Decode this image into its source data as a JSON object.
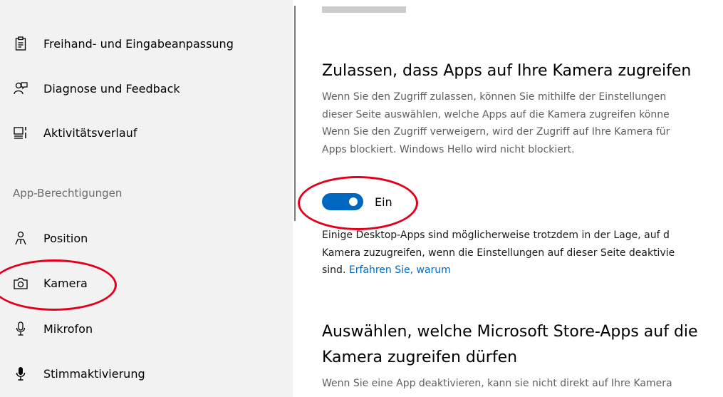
{
  "sidebar": {
    "items": [
      {
        "label": "Freihand- und Eingabeanpassung",
        "icon": "clipboard-icon"
      },
      {
        "label": "Diagnose und Feedback",
        "icon": "feedback-person-icon"
      },
      {
        "label": "Aktivitätsverlauf",
        "icon": "timeline-icon"
      }
    ],
    "section_label": "App-Berechtigungen",
    "permissions": [
      {
        "label": "Position",
        "icon": "location-person-icon"
      },
      {
        "label": "Kamera",
        "icon": "camera-icon"
      },
      {
        "label": "Mikrofon",
        "icon": "microphone-icon"
      },
      {
        "label": "Stimmaktivierung",
        "icon": "voice-activation-icon"
      }
    ]
  },
  "main": {
    "heading1": "Zulassen, dass Apps auf Ihre Kamera zugreifen",
    "desc1": [
      "Wenn Sie den Zugriff zulassen, können Sie mithilfe der Einstellungen",
      "dieser Seite auswählen, welche Apps auf die Kamera zugreifen könne",
      "Wenn Sie den Zugriff verweigern, wird der Zugriff auf Ihre Kamera für",
      "Apps blockiert. Windows Hello wird nicht blockiert."
    ],
    "toggle": {
      "state": "on",
      "label": "Ein"
    },
    "desc2": [
      "Einige Desktop-Apps sind möglicherweise trotzdem in der Lage, auf d",
      "Kamera zuzugreifen, wenn die Einstellungen auf dieser Seite deaktivie",
      "sind."
    ],
    "link": "Erfahren Sie, warum",
    "heading2": [
      "Auswählen, welche Microsoft Store-Apps auf die",
      "Kamera zugreifen dürfen"
    ],
    "desc3": "Wenn Sie eine App deaktivieren, kann sie nicht direkt auf Ihre Kamera"
  },
  "colors": {
    "accent": "#0067c0",
    "annotation": "#e2001a",
    "sidebar_bg": "#f2f2f2"
  }
}
